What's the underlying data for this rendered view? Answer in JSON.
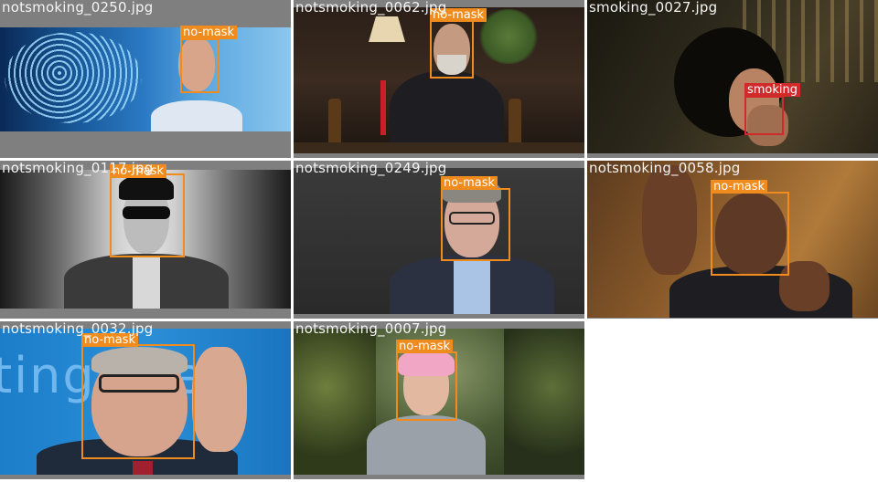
{
  "tiles": [
    {
      "filename": "notsmoking_0250.jpg",
      "label": "no-mask"
    },
    {
      "filename": "notsmoking_0062.jpg",
      "label": "no-mask"
    },
    {
      "filename": "smoking_0027.jpg",
      "label": "smoking"
    },
    {
      "filename": "notsmoking_0117.jpg",
      "label": "no-mask"
    },
    {
      "filename": "notsmoking_0249.jpg",
      "label": "no-mask"
    },
    {
      "filename": "notsmoking_0058.jpg",
      "label": "no-mask"
    },
    {
      "filename": "notsmoking_0032.jpg",
      "label": "no-mask"
    },
    {
      "filename": "notsmoking_0007.jpg",
      "label": "no-mask"
    }
  ],
  "text_overlay_0032": "ting  we",
  "colors": {
    "no_mask": "#f08c1e",
    "smoking": "#d12a2a",
    "filename_text": "#f4f4f4",
    "tile_padding": "#7f7f7f"
  }
}
